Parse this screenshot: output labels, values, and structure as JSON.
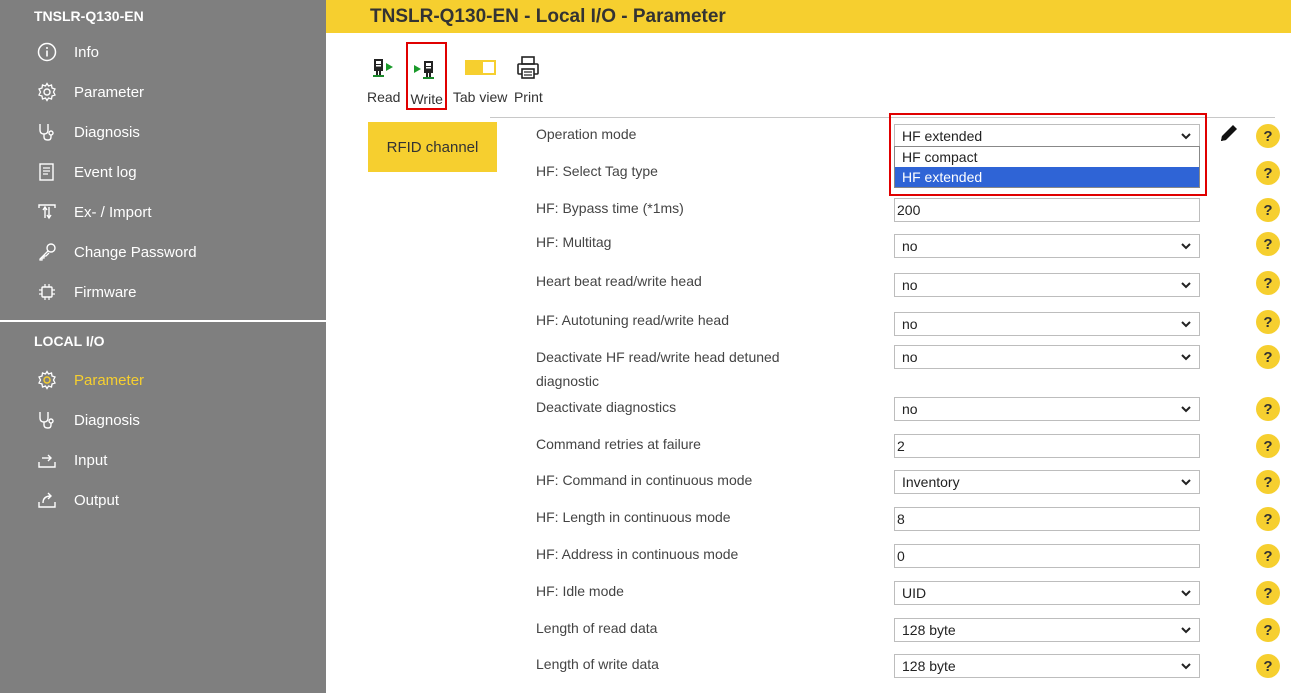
{
  "sidebar": {
    "device_title": "TNSLR-Q130-EN",
    "items": [
      {
        "label": "Info",
        "icon": "info-icon"
      },
      {
        "label": "Parameter",
        "icon": "gear-icon"
      },
      {
        "label": "Diagnosis",
        "icon": "stethoscope-icon"
      },
      {
        "label": "Event log",
        "icon": "event-log-icon"
      },
      {
        "label": "Ex- / Import",
        "icon": "import-export-icon"
      },
      {
        "label": "Change Password",
        "icon": "key-icon"
      },
      {
        "label": "Firmware",
        "icon": "chip-icon"
      }
    ],
    "section_title": "LOCAL I/O",
    "local_items": [
      {
        "label": "Parameter",
        "icon": "gear-icon",
        "active": true
      },
      {
        "label": "Diagnosis",
        "icon": "stethoscope-icon"
      },
      {
        "label": "Input",
        "icon": "input-icon"
      },
      {
        "label": "Output",
        "icon": "output-icon"
      }
    ]
  },
  "header": {
    "title": "TNSLR-Q130-EN - Local I/O - Parameter"
  },
  "toolbar": {
    "read_label": "Read",
    "write_label": "Write",
    "tabview_label": "Tab view",
    "print_label": "Print"
  },
  "channel": {
    "label": "RFID channel"
  },
  "params": [
    {
      "label": "Operation mode",
      "type": "select",
      "value": "HF extended"
    },
    {
      "label": "HF: Select Tag type",
      "type": "hidden",
      "value": ""
    },
    {
      "label": "HF: Bypass time (*1ms)",
      "type": "input",
      "value": "200"
    },
    {
      "label": "HF: Multitag",
      "type": "select",
      "value": "no"
    },
    {
      "label": "Heart beat read/write head",
      "type": "select",
      "value": "no"
    },
    {
      "label": "HF: Autotuning read/write head",
      "type": "select",
      "value": "no"
    },
    {
      "label": "Deactivate HF read/write head detuned diagnostic",
      "type": "select",
      "value": "no"
    },
    {
      "label": "Deactivate diagnostics",
      "type": "select",
      "value": "no"
    },
    {
      "label": "Command retries at failure",
      "type": "input",
      "value": "2"
    },
    {
      "label": "HF: Command in continuous mode",
      "type": "select",
      "value": "Inventory"
    },
    {
      "label": "HF: Length in continuous mode",
      "type": "input",
      "value": "8"
    },
    {
      "label": "HF: Address in continuous mode",
      "type": "input",
      "value": "0"
    },
    {
      "label": "HF: Idle mode",
      "type": "select",
      "value": "UID"
    },
    {
      "label": "Length of read data",
      "type": "select",
      "value": "128 byte"
    },
    {
      "label": "Length of write data",
      "type": "select",
      "value": "128 byte"
    }
  ],
  "dropdown": {
    "options": [
      "HF compact",
      "HF extended"
    ],
    "selected": "HF extended"
  },
  "help_glyph": "?",
  "colors": {
    "accent": "#f6cf2f",
    "sidebar": "#7f7f7f",
    "highlight": "#e00000",
    "selection": "#2f64d6"
  }
}
